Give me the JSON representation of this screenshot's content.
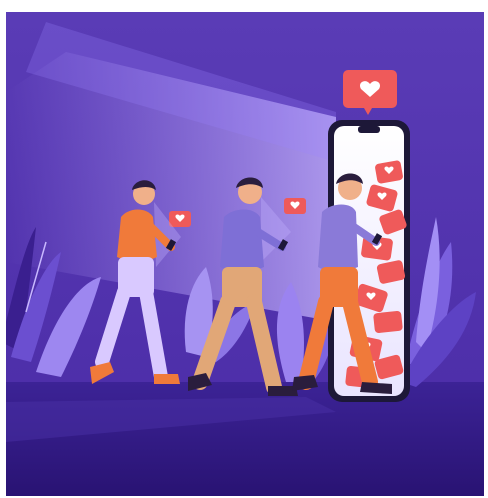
{
  "illustration": {
    "subject": "people-walking-on-phones-into-giant-smartphone",
    "icons": [
      "heart-notification-icon",
      "heart-like-icon"
    ],
    "colors": {
      "background_top": "#5b3fb8",
      "background_bottom": "#3a1f8f",
      "floor": "#2c1677",
      "accent_red": "#ef5a5a",
      "phone_body": "#1d1838",
      "orange_shirt": "#f07a3a",
      "purple_shirt": "#7e6fd6",
      "pants_tan": "#e1a777"
    }
  }
}
